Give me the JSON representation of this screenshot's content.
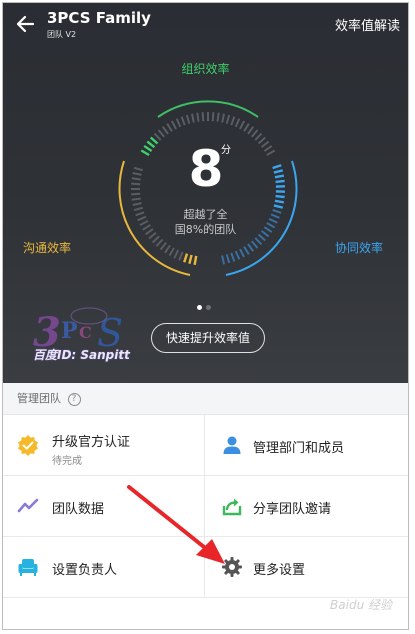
{
  "header": {
    "team_name": "3PCS Family",
    "team_subtitle": "团队 V2",
    "explain_link": "效率值解读"
  },
  "gauge": {
    "org_label": "组织效率",
    "comm_label": "沟通效率",
    "coop_label": "协同效率",
    "score": "8",
    "score_unit": "分",
    "beat_line1": "超越了全",
    "beat_line2": "国8%的团队",
    "colors": {
      "org": "#3fcf6a",
      "comm": "#e8b83c",
      "coop": "#3ba6f0"
    }
  },
  "boost_button": "快速提升效率值",
  "pager": {
    "pages": 2,
    "active": 0
  },
  "watermark": {
    "text": "百度ID: Sanpitt"
  },
  "management": {
    "title": "管理团队",
    "help": "?",
    "items": [
      {
        "label": "升级官方认证",
        "sub": "待完成",
        "icon": "verified-badge-icon",
        "color": "#f5b92a"
      },
      {
        "label": "管理部门和成员",
        "sub": "",
        "icon": "person-icon",
        "color": "#3b8fe0"
      },
      {
        "label": "团队数据",
        "sub": "",
        "icon": "trend-chart-icon",
        "color": "#8a7ad8"
      },
      {
        "label": "分享团队邀请",
        "sub": "",
        "icon": "share-icon",
        "color": "#3cb85f"
      },
      {
        "label": "设置负责人",
        "sub": "",
        "icon": "armchair-icon",
        "color": "#27b3e0"
      },
      {
        "label": "更多设置",
        "sub": "",
        "icon": "gear-icon",
        "color": "#555555"
      }
    ]
  },
  "corner_watermark": "Baidu 经验"
}
